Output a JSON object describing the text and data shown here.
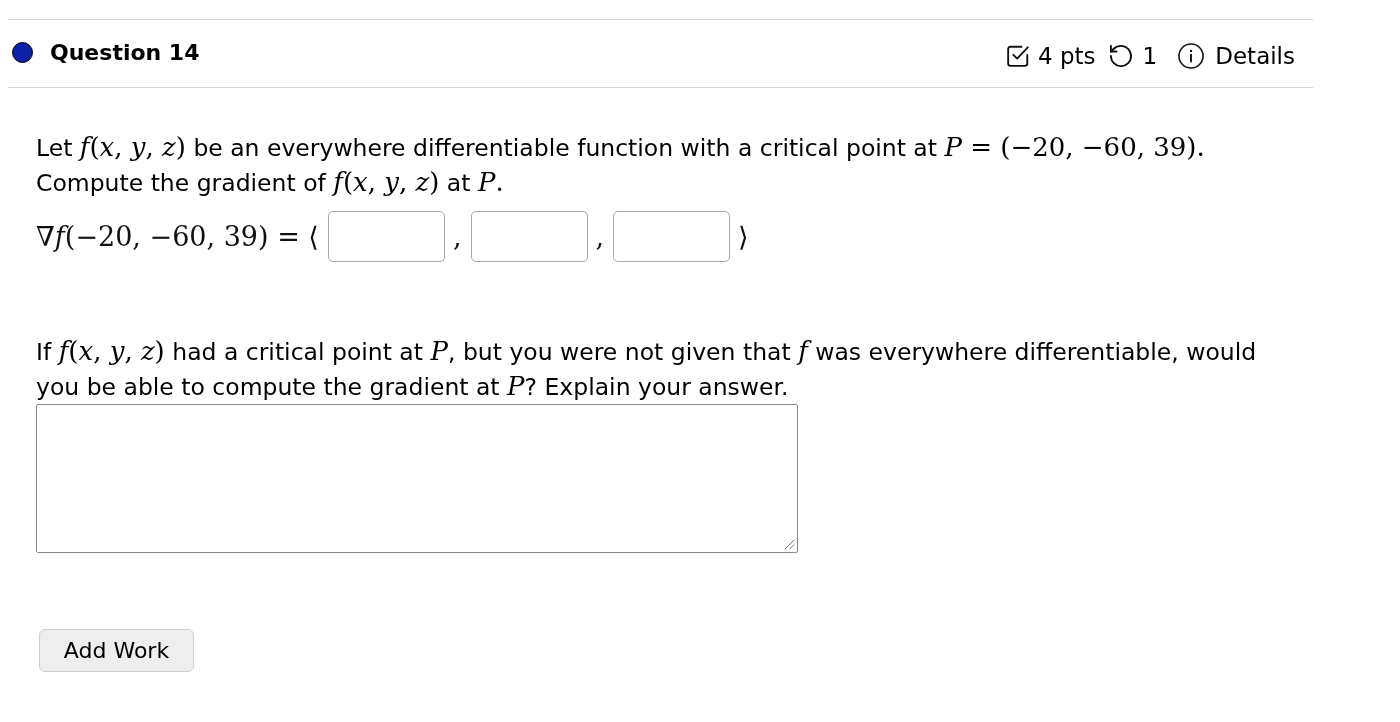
{
  "question": {
    "status_dot": true,
    "title": "Question 14",
    "points": "4 pts",
    "attempts": "1",
    "details": "Details"
  },
  "prompt_1": [
    {
      "kind": "text",
      "text": "Let "
    },
    {
      "kind": "math",
      "text": "*f*(*x*, *y*, *z*)"
    },
    {
      "kind": "text",
      "text": " be an everywhere differentiable function with a critical point at "
    },
    {
      "kind": "math",
      "text": "*P* = (−20, −60, 39)."
    },
    {
      "kind": "text",
      "text": " Compute the gradient of "
    },
    {
      "kind": "math",
      "text": "*f*(*x*, *y*, *z*)"
    },
    {
      "kind": "text",
      "text": " at "
    },
    {
      "kind": "math",
      "text": "*P*."
    }
  ],
  "gradient_row": [
    {
      "kind": "math",
      "text": "∇*f*(−20, −60, 39) = ⟨"
    },
    {
      "kind": "field"
    },
    {
      "kind": "math",
      "text": ","
    },
    {
      "kind": "field"
    },
    {
      "kind": "math",
      "text": ","
    },
    {
      "kind": "field"
    },
    {
      "kind": "math",
      "text": "⟩"
    }
  ],
  "prompt_2": [
    {
      "kind": "text",
      "text": "If "
    },
    {
      "kind": "math",
      "text": "*f*(*x*, *y*, *z*)"
    },
    {
      "kind": "text",
      "text": " had a critical point at "
    },
    {
      "kind": "math",
      "text": "*P*"
    },
    {
      "kind": "text",
      "text": ", but you were not given that "
    },
    {
      "kind": "math",
      "text": "*f*"
    },
    {
      "kind": "text",
      "text": " was everywhere differentiable, would you be able to compute the gradient at "
    },
    {
      "kind": "math",
      "text": "*P*"
    },
    {
      "kind": "text",
      "text": "? Explain your answer."
    }
  ],
  "answer_box": {
    "resizable": true
  },
  "add_work_button": "Add Work"
}
